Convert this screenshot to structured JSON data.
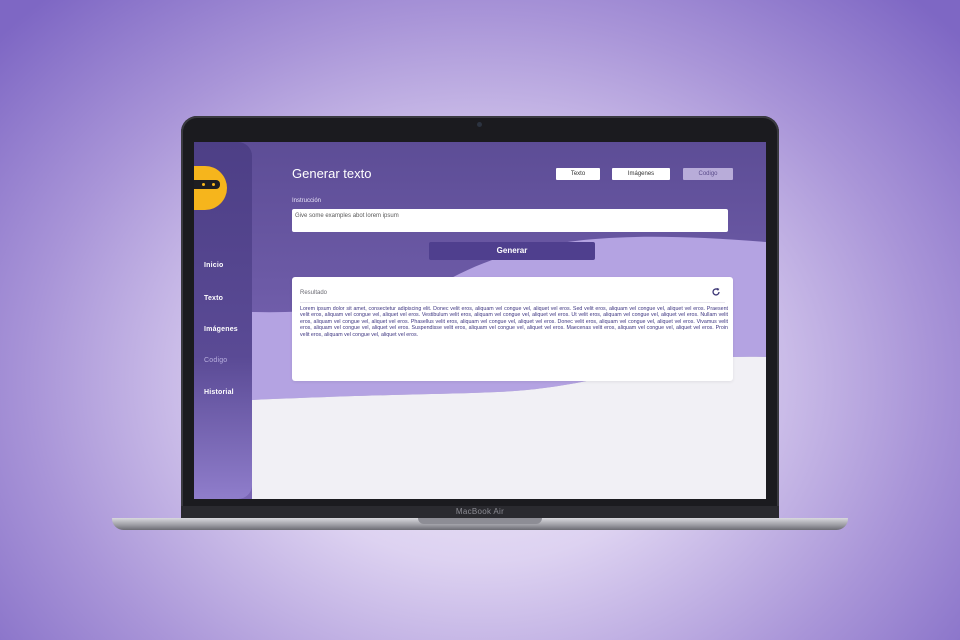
{
  "device": {
    "label": "MacBook Air"
  },
  "sidebar": {
    "items": [
      {
        "label": "Inicio"
      },
      {
        "label": "Texto"
      },
      {
        "label": "Imágenes"
      },
      {
        "label": "Codigo"
      },
      {
        "label": "Historial"
      }
    ]
  },
  "header": {
    "title": "Generar texto",
    "tabs": [
      {
        "label": "Texto"
      },
      {
        "label": "Imágenes"
      },
      {
        "label": "Codigo"
      }
    ]
  },
  "instruction": {
    "label": "Instrucción",
    "value": "Give some examples abot lorem ipsum"
  },
  "generate_button": {
    "label": "Generar"
  },
  "result": {
    "title": "Resultado",
    "text": "Lorem ipsum dolor sit amet, consectetur adipiscing elit. Donec velit eros, aliquam vel congue vel, aliquet vel eros. Sed velit eros, aliquam vel congue vel, aliquet vel eros. Praesent velit eros, aliquam vel congue vel, aliquet vel eros. Vestibulum velit eros, aliquam vel congue vel, aliquet vel eros. Ut velit eros, aliquam vel congue vel, aliquet vel eros. Nullam velit eros, aliquam vel congue vel, aliquet vel eros. Phasellus velit eros, aliquam vel congue vel, aliquet vel eros. Donec velit eros, aliquam vel congue vel, aliquet vel eros. Vivamus velit eros, aliquam vel congue vel, aliquet vel eros. Suspendisse velit eros, aliquam vel congue vel, aliquet vel eros. Maecenas velit eros, aliquam vel congue vel, aliquet vel eros. Proin velit eros, aliquam vel congue vel, aliquet vel eros."
  },
  "colors": {
    "primary": "#4f3f8e",
    "logo": "#f6b51c",
    "wave": "#b4a3e2",
    "background": "#f1f0f5"
  }
}
